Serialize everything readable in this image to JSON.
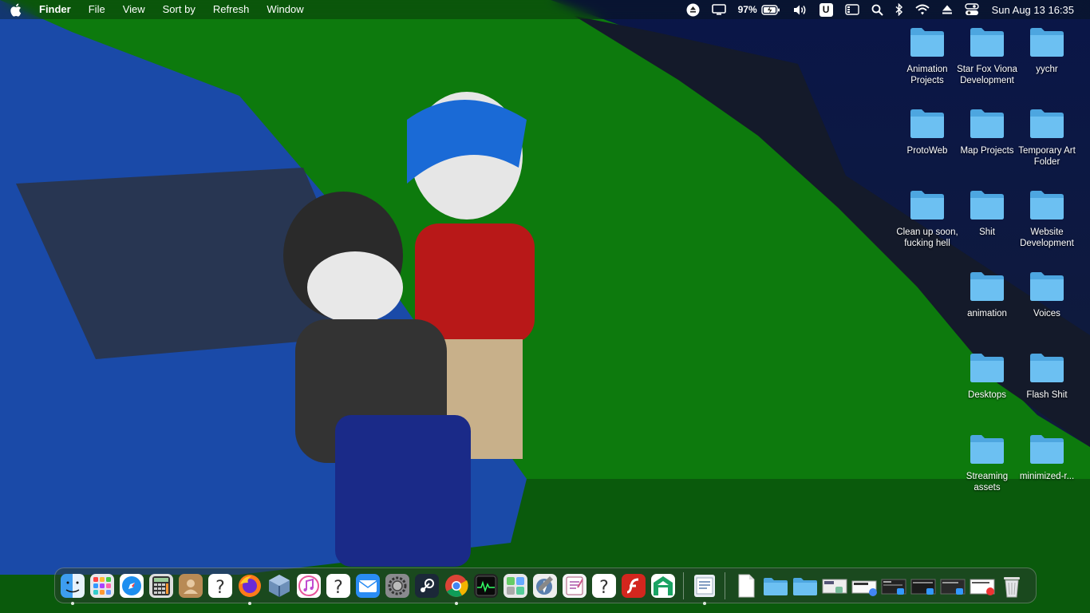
{
  "menubar": {
    "app_name": "Finder",
    "menus": [
      "File",
      "View",
      "Sort by",
      "Refresh",
      "Window"
    ],
    "status": {
      "battery_percent": "97%",
      "user_badge": "U",
      "clock": "Sun Aug 13 16:35"
    }
  },
  "desktop": {
    "folder_color": "#5fb3e8",
    "icons": [
      {
        "label": "Animation Projects"
      },
      {
        "label": "Star Fox Viona Development"
      },
      {
        "label": "yychr"
      },
      {
        "label": "ProtoWeb"
      },
      {
        "label": "Map Projects"
      },
      {
        "label": "Temporary Art Folder"
      },
      {
        "label": "Clean up soon, fucking hell"
      },
      {
        "label": "Shit"
      },
      {
        "label": "Website Development"
      },
      {
        "label": "animation"
      },
      {
        "label": "Voices"
      },
      {
        "label": "Desktops"
      },
      {
        "label": "Flash Shit"
      },
      {
        "label": "Streaming assets"
      },
      {
        "label": "minimized-r..."
      }
    ]
  },
  "dock": {
    "apps": [
      {
        "name": "finder-icon",
        "running": true
      },
      {
        "name": "launchpad-icon",
        "running": false
      },
      {
        "name": "safari-icon",
        "running": false
      },
      {
        "name": "calculator-icon",
        "running": false
      },
      {
        "name": "contacts-icon",
        "running": false
      },
      {
        "name": "unknown-app-icon",
        "running": false
      },
      {
        "name": "firefox-icon",
        "running": true
      },
      {
        "name": "virtualbox-icon",
        "running": false
      },
      {
        "name": "music-icon",
        "running": false
      },
      {
        "name": "unknown-app-icon",
        "running": false
      },
      {
        "name": "mail-icon",
        "running": false
      },
      {
        "name": "system-settings-icon",
        "running": false
      },
      {
        "name": "steam-icon",
        "running": false
      },
      {
        "name": "chrome-icon",
        "running": true
      },
      {
        "name": "activity-monitor-icon",
        "running": false
      },
      {
        "name": "puzzle-app-icon",
        "running": false
      },
      {
        "name": "directory-utility-icon",
        "running": false
      },
      {
        "name": "script-editor-icon",
        "running": false
      },
      {
        "name": "unknown-app-icon",
        "running": false
      },
      {
        "name": "flash-player-icon",
        "running": false
      },
      {
        "name": "green-app-icon",
        "running": false
      }
    ],
    "recent": [
      {
        "name": "document-viewer-icon",
        "running": true
      }
    ],
    "stacks": [
      {
        "name": "document-stack-icon"
      },
      {
        "name": "folder-stack-icon"
      },
      {
        "name": "folder-stack-icon"
      },
      {
        "name": "minimized-window-icon"
      },
      {
        "name": "minimized-window-icon"
      },
      {
        "name": "minimized-window-icon"
      },
      {
        "name": "minimized-window-icon"
      },
      {
        "name": "minimized-window-icon"
      },
      {
        "name": "minimized-window-icon"
      },
      {
        "name": "trash-icon"
      }
    ]
  }
}
